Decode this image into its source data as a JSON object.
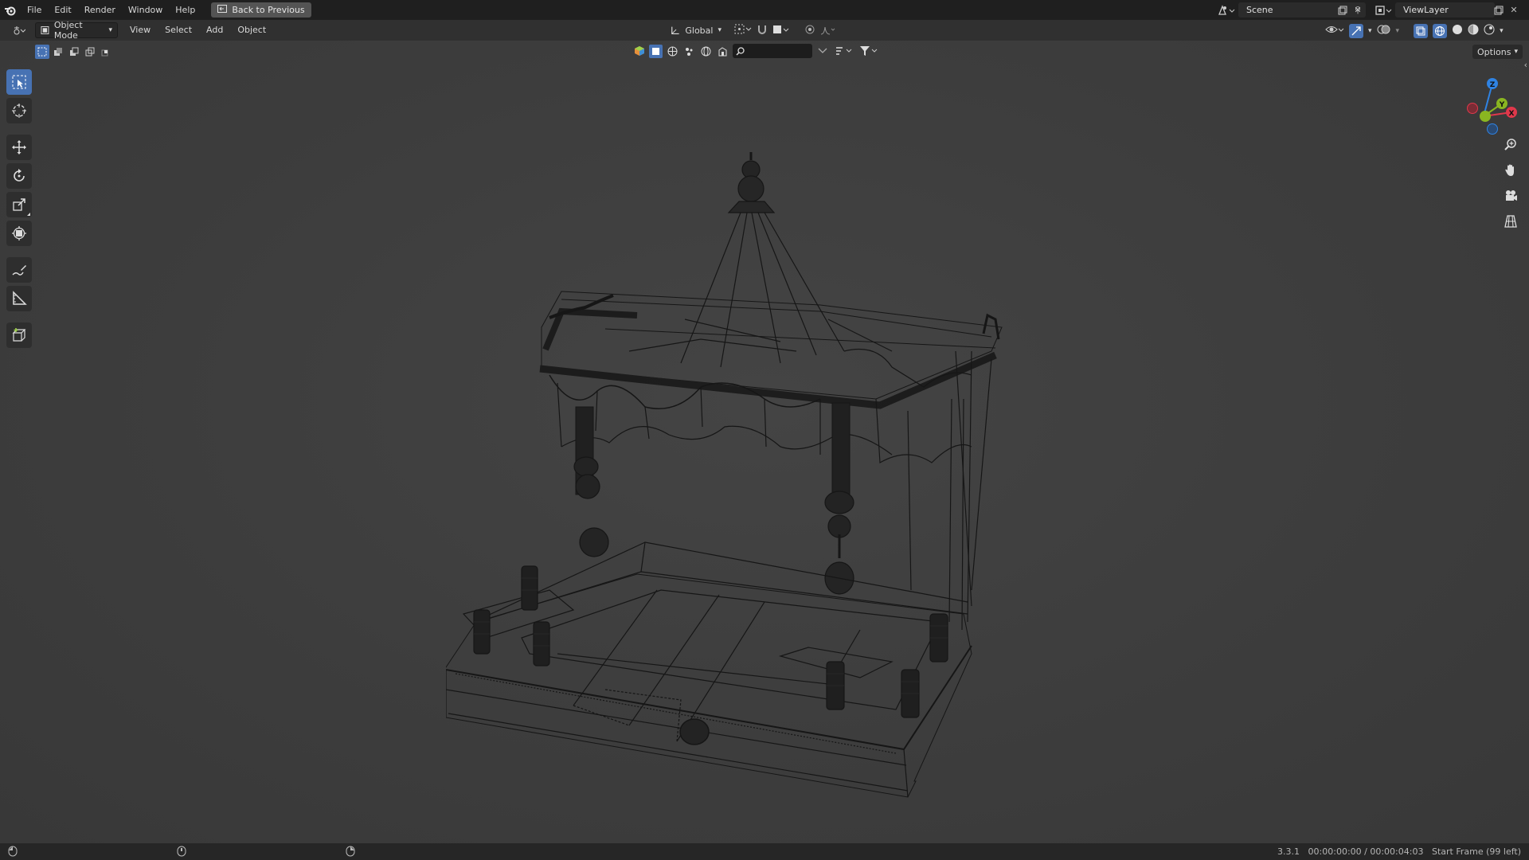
{
  "topbar": {
    "menus": [
      "File",
      "Edit",
      "Render",
      "Window",
      "Help"
    ],
    "back_button": "Back to Previous",
    "scene": "Scene",
    "view_layer": "ViewLayer"
  },
  "header": {
    "mode": "Object Mode",
    "menus": [
      "View",
      "Select",
      "Add",
      "Object"
    ],
    "orientation": "Global"
  },
  "viewport": {
    "options_label": "Options",
    "search_placeholder": "",
    "gizmo_axes": [
      "X",
      "Y",
      "Z"
    ]
  },
  "status": {
    "version": "3.3.1",
    "timecode": "00:00:00:00 / 00:00:04:03",
    "frame_info": "Start Frame (99 left)"
  },
  "colors": {
    "accent": "#4772b3",
    "x_axis": "#e0384b",
    "y_axis": "#8ab621",
    "z_axis": "#2f83e3"
  },
  "icons": {
    "logo": "blender-logo-icon",
    "tools": [
      "select-box-icon",
      "cursor-icon",
      "move-icon",
      "rotate-icon",
      "scale-icon",
      "transform-icon",
      "annotate-icon",
      "measure-icon",
      "add-cube-icon"
    ],
    "nav": [
      "zoom-icon",
      "pan-hand-icon",
      "camera-icon",
      "grid-icon"
    ]
  }
}
